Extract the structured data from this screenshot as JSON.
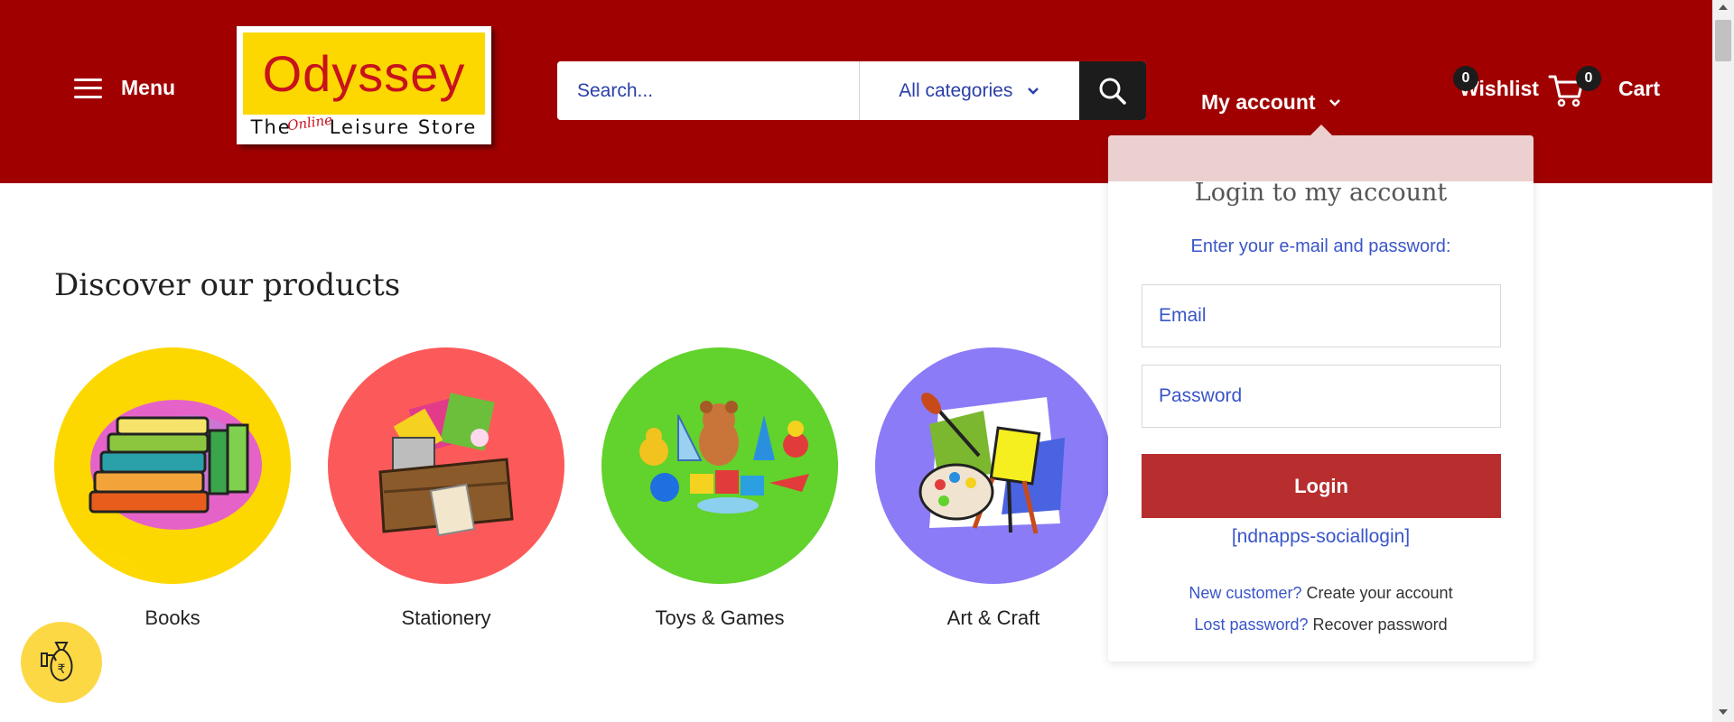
{
  "header": {
    "menu_label": "Menu",
    "logo": {
      "brand": "Odyssey",
      "tagline_start": "The",
      "tagline_online": "Online",
      "tagline_end": "Leisure Store"
    },
    "search": {
      "placeholder": "Search...",
      "category_label": "All categories"
    },
    "account_label": "My account",
    "wishlist_label": "Wishlist",
    "wishlist_count": "0",
    "cart_label": "Cart",
    "cart_count": "0",
    "colors": {
      "background": "#a00000",
      "search_button": "#1c1c1c"
    }
  },
  "main": {
    "title": "Discover our products",
    "categories": [
      {
        "label": "Books",
        "color": "#fdd800",
        "icon": "books-icon"
      },
      {
        "label": "Stationery",
        "color": "#fc5a5a",
        "icon": "stationery-icon"
      },
      {
        "label": "Toys & Games",
        "color": "#62d22c",
        "icon": "toys-icon"
      },
      {
        "label": "Art & Craft",
        "color": "#8b7bf6",
        "icon": "art-icon"
      }
    ]
  },
  "login": {
    "title": "Login to my account",
    "subtitle": "Enter your e-mail and password:",
    "email_placeholder": "Email",
    "password_placeholder": "Password",
    "login_button": "Login",
    "social_shortcode": "[ndnapps-sociallogin]",
    "new_customer_q": "New customer?",
    "new_customer_a": "Create your account",
    "lost_password_q": "Lost password?",
    "lost_password_a": "Recover password",
    "button_color": "#b82e2e"
  },
  "widget": {
    "icon": "rupee-money-bag-icon",
    "color": "#fdd845"
  }
}
